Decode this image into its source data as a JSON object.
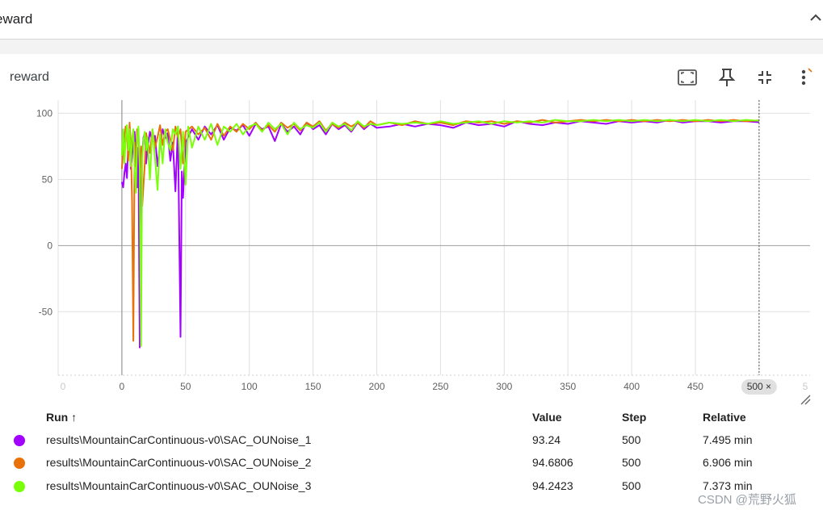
{
  "section": {
    "title": "eward"
  },
  "card": {
    "title": "reward"
  },
  "toolbar": {
    "fit_icon": "fit-domain-icon",
    "pin_icon": "pin-icon",
    "collapse_icon": "collapse-arrows-icon",
    "more_icon": "more-vert-icon"
  },
  "chart_data": {
    "type": "line",
    "title": "reward",
    "xlabel": "",
    "ylabel": "",
    "xlim": [
      -50,
      540
    ],
    "ylim": [
      -98,
      110
    ],
    "x_ticks": [
      0,
      50,
      100,
      150,
      200,
      250,
      300,
      350,
      400,
      450,
      500
    ],
    "x_tick_labels": [
      "0",
      "50",
      "100",
      "150",
      "200",
      "250",
      "300",
      "350",
      "400",
      "450",
      "500"
    ],
    "x_tick_partial_labels": {
      "left": "0",
      "right": "5"
    },
    "y_ticks": [
      100,
      50,
      0,
      -50
    ],
    "y_tick_labels": [
      "100",
      "50",
      "0",
      "-50"
    ],
    "hover_step": 500,
    "hover_label": "500 ×",
    "grid": true,
    "series": [
      {
        "name": "results\\MountainCarContinuous-v0\\SAC_OUNoise_1",
        "color": "#a200ff",
        "points": [
          [
            0,
            48
          ],
          [
            1,
            44
          ],
          [
            2,
            55
          ],
          [
            3,
            62
          ],
          [
            4,
            51
          ],
          [
            5,
            78
          ],
          [
            6,
            86
          ],
          [
            7,
            58
          ],
          [
            8,
            67
          ],
          [
            9,
            79
          ],
          [
            10,
            86
          ],
          [
            11,
            68
          ],
          [
            12,
            44
          ],
          [
            13,
            74
          ],
          [
            14,
            -77
          ],
          [
            15,
            42
          ],
          [
            16,
            69
          ],
          [
            17,
            82
          ],
          [
            18,
            85
          ],
          [
            19,
            62
          ],
          [
            20,
            73
          ],
          [
            22,
            86
          ],
          [
            24,
            79
          ],
          [
            26,
            83
          ],
          [
            28,
            60
          ],
          [
            30,
            76
          ],
          [
            32,
            88
          ],
          [
            34,
            81
          ],
          [
            36,
            85
          ],
          [
            38,
            64
          ],
          [
            40,
            78
          ],
          [
            42,
            41
          ],
          [
            44,
            90
          ],
          [
            46,
            -69
          ],
          [
            47,
            56
          ],
          [
            48,
            36
          ],
          [
            50,
            78
          ],
          [
            55,
            88
          ],
          [
            60,
            80
          ],
          [
            65,
            90
          ],
          [
            70,
            84
          ],
          [
            75,
            91
          ],
          [
            80,
            80
          ],
          [
            85,
            89
          ],
          [
            90,
            87
          ],
          [
            95,
            91
          ],
          [
            100,
            83
          ],
          [
            105,
            92
          ],
          [
            110,
            88
          ],
          [
            115,
            90
          ],
          [
            120,
            79
          ],
          [
            125,
            92
          ],
          [
            130,
            86
          ],
          [
            135,
            90
          ],
          [
            140,
            84
          ],
          [
            145,
            93
          ],
          [
            150,
            88
          ],
          [
            155,
            91
          ],
          [
            160,
            84
          ],
          [
            165,
            92
          ],
          [
            170,
            88
          ],
          [
            175,
            91
          ],
          [
            180,
            86
          ],
          [
            185,
            93
          ],
          [
            190,
            88
          ],
          [
            195,
            92
          ],
          [
            200,
            89
          ],
          [
            210,
            90
          ],
          [
            220,
            92
          ],
          [
            230,
            90
          ],
          [
            240,
            92
          ],
          [
            250,
            91
          ],
          [
            260,
            89
          ],
          [
            270,
            93
          ],
          [
            280,
            91
          ],
          [
            290,
            92
          ],
          [
            300,
            90
          ],
          [
            310,
            94
          ],
          [
            320,
            92
          ],
          [
            330,
            91
          ],
          [
            340,
            93
          ],
          [
            350,
            92
          ],
          [
            360,
            94
          ],
          [
            370,
            93
          ],
          [
            380,
            92
          ],
          [
            390,
            94
          ],
          [
            400,
            93
          ],
          [
            410,
            94
          ],
          [
            420,
            93
          ],
          [
            430,
            95
          ],
          [
            440,
            93
          ],
          [
            450,
            94
          ],
          [
            460,
            94
          ],
          [
            470,
            93
          ],
          [
            480,
            94
          ],
          [
            490,
            94
          ],
          [
            500,
            93.24
          ]
        ]
      },
      {
        "name": "results\\MountainCarContinuous-v0\\SAC_OUNoise_2",
        "color": "#e8710a",
        "points": [
          [
            0,
            58
          ],
          [
            1,
            72
          ],
          [
            2,
            83
          ],
          [
            3,
            90
          ],
          [
            4,
            86
          ],
          [
            5,
            64
          ],
          [
            6,
            93
          ],
          [
            7,
            79
          ],
          [
            8,
            34
          ],
          [
            9,
            -72
          ],
          [
            10,
            78
          ],
          [
            11,
            60
          ],
          [
            12,
            88
          ],
          [
            13,
            84
          ],
          [
            14,
            58
          ],
          [
            15,
            75
          ],
          [
            16,
            30
          ],
          [
            17,
            46
          ],
          [
            18,
            62
          ],
          [
            19,
            85
          ],
          [
            20,
            80
          ],
          [
            22,
            70
          ],
          [
            24,
            88
          ],
          [
            26,
            74
          ],
          [
            28,
            82
          ],
          [
            30,
            91
          ],
          [
            32,
            76
          ],
          [
            34,
            86
          ],
          [
            36,
            88
          ],
          [
            38,
            80
          ],
          [
            40,
            72
          ],
          [
            42,
            90
          ],
          [
            44,
            82
          ],
          [
            46,
            88
          ],
          [
            48,
            62
          ],
          [
            50,
            86
          ],
          [
            55,
            90
          ],
          [
            60,
            84
          ],
          [
            65,
            89
          ],
          [
            70,
            80
          ],
          [
            75,
            92
          ],
          [
            80,
            83
          ],
          [
            85,
            90
          ],
          [
            90,
            86
          ],
          [
            95,
            92
          ],
          [
            100,
            88
          ],
          [
            105,
            93
          ],
          [
            110,
            87
          ],
          [
            115,
            91
          ],
          [
            120,
            86
          ],
          [
            125,
            93
          ],
          [
            130,
            89
          ],
          [
            135,
            92
          ],
          [
            140,
            87
          ],
          [
            145,
            93
          ],
          [
            150,
            90
          ],
          [
            155,
            94
          ],
          [
            160,
            87
          ],
          [
            165,
            92
          ],
          [
            170,
            89
          ],
          [
            175,
            93
          ],
          [
            180,
            90
          ],
          [
            185,
            93
          ],
          [
            190,
            89
          ],
          [
            195,
            94
          ],
          [
            200,
            91
          ],
          [
            210,
            93
          ],
          [
            220,
            91
          ],
          [
            230,
            94
          ],
          [
            240,
            92
          ],
          [
            250,
            93
          ],
          [
            260,
            91
          ],
          [
            270,
            94
          ],
          [
            280,
            93
          ],
          [
            290,
            94
          ],
          [
            300,
            92
          ],
          [
            310,
            94
          ],
          [
            320,
            93
          ],
          [
            330,
            95
          ],
          [
            340,
            93
          ],
          [
            350,
            94
          ],
          [
            360,
            95
          ],
          [
            370,
            94
          ],
          [
            380,
            95
          ],
          [
            390,
            94
          ],
          [
            400,
            95
          ],
          [
            410,
            94
          ],
          [
            420,
            95
          ],
          [
            430,
            94
          ],
          [
            440,
            95
          ],
          [
            450,
            94
          ],
          [
            460,
            95
          ],
          [
            470,
            94
          ],
          [
            480,
            95
          ],
          [
            490,
            94
          ],
          [
            500,
            94.6806
          ]
        ]
      },
      {
        "name": "results\\MountainCarContinuous-v0\\SAC_OUNoise_3",
        "color": "#7aff0a",
        "points": [
          [
            0,
            68
          ],
          [
            1,
            88
          ],
          [
            2,
            62
          ],
          [
            3,
            80
          ],
          [
            4,
            91
          ],
          [
            5,
            72
          ],
          [
            6,
            88
          ],
          [
            7,
            60
          ],
          [
            8,
            80
          ],
          [
            9,
            88
          ],
          [
            10,
            56
          ],
          [
            11,
            40
          ],
          [
            12,
            80
          ],
          [
            13,
            90
          ],
          [
            14,
            60
          ],
          [
            15,
            -76
          ],
          [
            16,
            66
          ],
          [
            17,
            80
          ],
          [
            18,
            86
          ],
          [
            19,
            72
          ],
          [
            20,
            82
          ],
          [
            22,
            50
          ],
          [
            24,
            88
          ],
          [
            26,
            66
          ],
          [
            28,
            42
          ],
          [
            30,
            84
          ],
          [
            32,
            62
          ],
          [
            34,
            88
          ],
          [
            36,
            78
          ],
          [
            38,
            72
          ],
          [
            40,
            88
          ],
          [
            42,
            84
          ],
          [
            44,
            90
          ],
          [
            46,
            58
          ],
          [
            48,
            86
          ],
          [
            50,
            46
          ],
          [
            52,
            90
          ],
          [
            55,
            74
          ],
          [
            60,
            90
          ],
          [
            65,
            80
          ],
          [
            70,
            92
          ],
          [
            75,
            76
          ],
          [
            80,
            90
          ],
          [
            85,
            86
          ],
          [
            90,
            92
          ],
          [
            95,
            84
          ],
          [
            100,
            90
          ],
          [
            105,
            92
          ],
          [
            110,
            86
          ],
          [
            115,
            93
          ],
          [
            120,
            88
          ],
          [
            125,
            92
          ],
          [
            130,
            84
          ],
          [
            135,
            93
          ],
          [
            140,
            88
          ],
          [
            145,
            91
          ],
          [
            150,
            89
          ],
          [
            155,
            93
          ],
          [
            160,
            86
          ],
          [
            165,
            93
          ],
          [
            170,
            90
          ],
          [
            175,
            92
          ],
          [
            180,
            87
          ],
          [
            185,
            94
          ],
          [
            190,
            90
          ],
          [
            195,
            92
          ],
          [
            200,
            91
          ],
          [
            210,
            93
          ],
          [
            220,
            92
          ],
          [
            230,
            93
          ],
          [
            240,
            92
          ],
          [
            250,
            94
          ],
          [
            260,
            92
          ],
          [
            270,
            93
          ],
          [
            280,
            94
          ],
          [
            290,
            92
          ],
          [
            300,
            94
          ],
          [
            310,
            93
          ],
          [
            320,
            94
          ],
          [
            330,
            93
          ],
          [
            340,
            95
          ],
          [
            350,
            94
          ],
          [
            360,
            94
          ],
          [
            370,
            95
          ],
          [
            380,
            94
          ],
          [
            390,
            95
          ],
          [
            400,
            94
          ],
          [
            410,
            95
          ],
          [
            420,
            94
          ],
          [
            430,
            95
          ],
          [
            440,
            94
          ],
          [
            450,
            95
          ],
          [
            460,
            94
          ],
          [
            470,
            95
          ],
          [
            480,
            94
          ],
          [
            490,
            95
          ],
          [
            500,
            94.2423
          ]
        ]
      }
    ]
  },
  "table": {
    "headers": {
      "run": "Run ↑",
      "value": "Value",
      "step": "Step",
      "relative": "Relative"
    },
    "rows": [
      {
        "run": "results\\MountainCarContinuous-v0\\SAC_OUNoise_1",
        "color": "#a200ff",
        "value": "93.24",
        "step": "500",
        "relative": "7.495 min"
      },
      {
        "run": "results\\MountainCarContinuous-v0\\SAC_OUNoise_2",
        "color": "#e8710a",
        "value": "94.6806",
        "step": "500",
        "relative": "6.906 min"
      },
      {
        "run": "results\\MountainCarContinuous-v0\\SAC_OUNoise_3",
        "color": "#7aff0a",
        "value": "94.2423",
        "step": "500",
        "relative": "7.373 min"
      }
    ]
  },
  "watermark": "CSDN @荒野火狐"
}
